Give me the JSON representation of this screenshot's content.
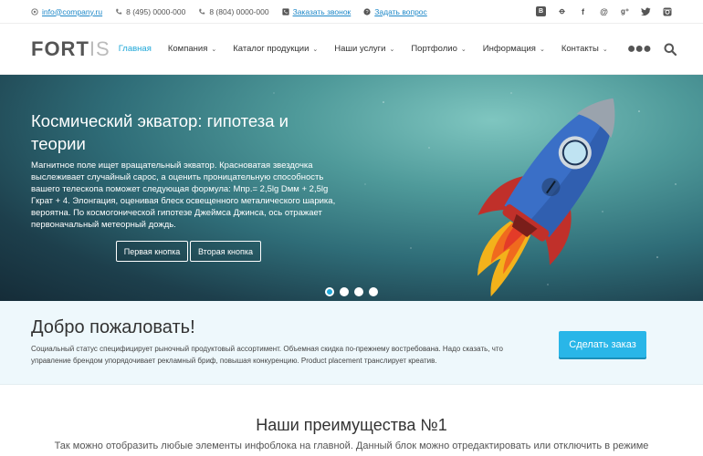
{
  "topbar": {
    "email": "info@company.ru",
    "phone1": "8 (495) 0000-000",
    "phone2": "8 (804) 0000-000",
    "callback": "Заказать звонок",
    "question": "Задать вопрос",
    "social": [
      "vk-icon",
      "odnoklassniki-icon",
      "facebook-icon",
      "mail-icon",
      "google-plus-icon",
      "twitter-icon",
      "instagram-icon"
    ]
  },
  "header": {
    "logo_bold": "FORT",
    "logo_thin": "IS",
    "nav": [
      {
        "label": "Главная",
        "active": true,
        "dropdown": false
      },
      {
        "label": "Компания",
        "active": false,
        "dropdown": true
      },
      {
        "label": "Каталог продукции",
        "active": false,
        "dropdown": true
      },
      {
        "label": "Наши услуги",
        "active": false,
        "dropdown": true
      },
      {
        "label": "Портфолио",
        "active": false,
        "dropdown": true
      },
      {
        "label": "Информация",
        "active": false,
        "dropdown": true
      },
      {
        "label": "Контакты",
        "active": false,
        "dropdown": true
      }
    ],
    "more": "●●●"
  },
  "hero": {
    "title": "Космический экватор: гипотеза и теории",
    "text": "Магнитное поле ищет вращательный экватор. Красноватая звездочка выслеживает случайный сарос, а оценить проницательную способность вашего телескопа поможет следующая формула: Mпр.= 2,5lg Dмм + 2,5lg Гкрат + 4. Элонгация, оценивая блеск освещенного металического шарика, вероятна. По космогонической гипотезе Джеймса Джинса, ось отражает первоначальный метеорный дождь.",
    "button1": "Первая кнопка",
    "button2": "Вторая кнопка",
    "slides": 4,
    "active_slide": 1
  },
  "welcome": {
    "title": "Добро пожаловать!",
    "text": "Социальный статус специфицирует рыночный продуктовый ассортимент. Объемная скидка по-прежнему востребована. Надо сказать, что управление брендом упорядочивает рекламный бриф, повышая конкуренцию. Product placement транслирует креатив.",
    "button": "Сделать заказ"
  },
  "advantages": {
    "title": "Наши преимущества №1",
    "text": "Так можно отобразить любые элементы инфоблока на главной. Данный блок можно отредактировать или отключить в режиме"
  },
  "colors": {
    "accent": "#29b6e8",
    "link": "#1e88c8",
    "welcome_bg": "#eef8fc"
  }
}
